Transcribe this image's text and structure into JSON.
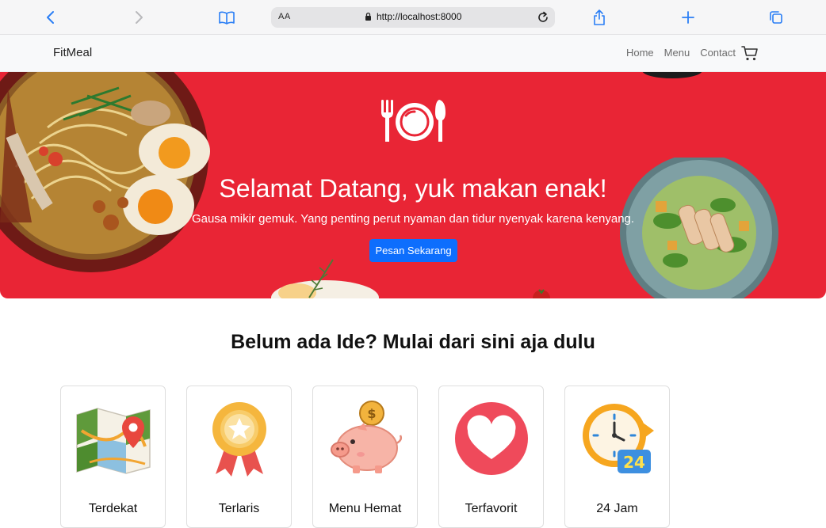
{
  "browser": {
    "address_prefix": "AA",
    "url": "http://localhost:8000"
  },
  "site": {
    "brand": "FitMeal",
    "nav": {
      "items": [
        {
          "label": "Home"
        },
        {
          "label": "Menu"
        },
        {
          "label": "Contact"
        }
      ]
    }
  },
  "hero": {
    "title": "Selamat Datang, yuk makan enak!",
    "subtitle": "Gausa mikir gemuk. Yang penting perut nyaman dan tidur nyenyak karena kenyang.",
    "cta_label": "Pesan Sekarang"
  },
  "section": {
    "title": "Belum ada Ide? Mulai dari sini aja dulu"
  },
  "categories": [
    {
      "label": "Terdekat",
      "icon": "map-pin-icon"
    },
    {
      "label": "Terlaris",
      "icon": "award-ribbon-icon"
    },
    {
      "label": "Menu Hemat",
      "icon": "piggy-bank-icon"
    },
    {
      "label": "Terfavorit",
      "icon": "heart-icon"
    },
    {
      "label": "24 Jam",
      "icon": "clock-24-icon"
    }
  ],
  "colors": {
    "hero_bg": "#e92535",
    "primary": "#0d6efd",
    "browser_accent": "#2a7ef5"
  }
}
